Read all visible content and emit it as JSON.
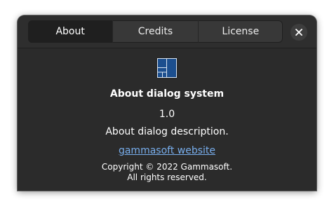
{
  "tabs": [
    {
      "label": "About"
    },
    {
      "label": "Credits"
    },
    {
      "label": "License"
    }
  ],
  "close_icon": "close-icon",
  "app": {
    "icon": "windows-layout-icon",
    "name": "About dialog system",
    "version": "1.0",
    "description": "About dialog description.",
    "website_label": "gammasoft website",
    "copyright_line1": "Copyright © 2022 Gammasoft.",
    "copyright_line2": "All rights reserved."
  },
  "colors": {
    "dialog_background": "#2b2b2b",
    "active_tab": "#1f1f1f",
    "link": "#78aeed",
    "icon_blue": "#1c4f8f"
  }
}
